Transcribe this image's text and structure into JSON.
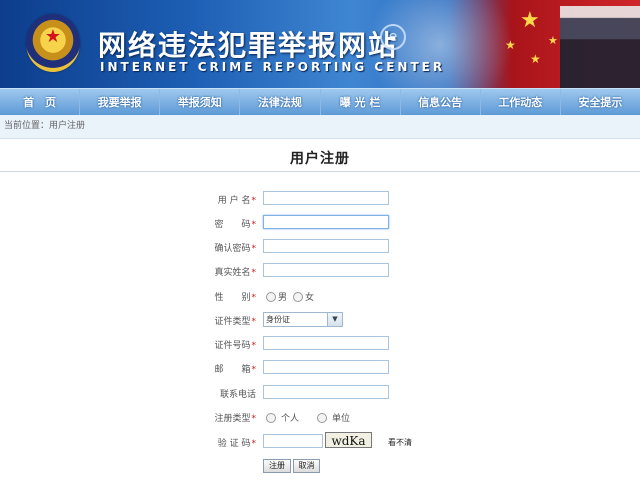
{
  "header": {
    "title": "网络违法犯罪举报网站",
    "subtitle": "INTERNET CRIME REPORTING CENTER",
    "emblem": "police-emblem",
    "e_icon": "e"
  },
  "nav": {
    "items": [
      "首　页",
      "我要举报",
      "举报须知",
      "法律法规",
      "曝 光 栏",
      "信息公告",
      "工作动态",
      "安全提示"
    ]
  },
  "breadcrumb": {
    "text": "当前位置：用户注册"
  },
  "page_title": "用户注册",
  "form": {
    "username_label": "用 户 名",
    "password_label": "密　　码",
    "confirm_label": "确认密码",
    "realname_label": "真实姓名",
    "gender_label": "性　　别",
    "gender_male": "男",
    "gender_female": "女",
    "idtype_label": "证件类型",
    "idtype_value": "身份证",
    "idnum_label": "证件号码",
    "email_label": "邮　　箱",
    "phone_label": "联系电话",
    "regtype_label": "注册类型",
    "regtype_personal": "个人",
    "regtype_org": "单位",
    "captcha_label": "验 证 码",
    "captcha_value": "wdKa",
    "captcha_refresh": "看不清",
    "required_mark": "*"
  },
  "buttons": {
    "register": "注册",
    "cancel": "取消"
  },
  "colors": {
    "required": "#d21a1a",
    "nav_top": "#9fc8ee",
    "nav_bottom": "#5d9ad6"
  }
}
